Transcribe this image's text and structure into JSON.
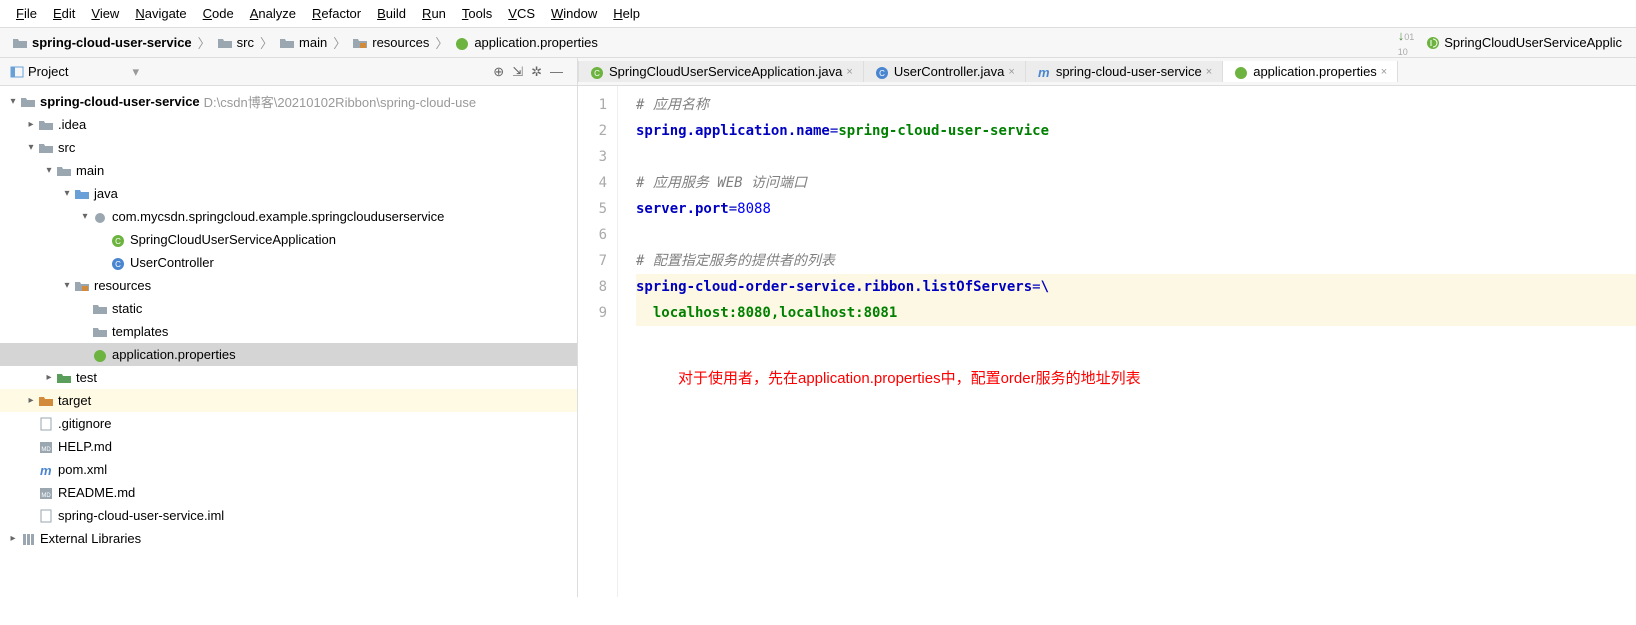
{
  "menu": [
    "File",
    "Edit",
    "View",
    "Navigate",
    "Code",
    "Analyze",
    "Refactor",
    "Build",
    "Run",
    "Tools",
    "VCS",
    "Window",
    "Help"
  ],
  "breadcrumb": [
    {
      "label": "spring-cloud-user-service",
      "bold": true,
      "icon": "folder"
    },
    {
      "label": "src",
      "icon": "folder"
    },
    {
      "label": "main",
      "icon": "folder"
    },
    {
      "label": "resources",
      "icon": "folder-res"
    },
    {
      "label": "application.properties",
      "icon": "spring"
    }
  ],
  "runConfig": "SpringCloudUserServiceApplic",
  "projectLabel": "Project",
  "tabs": [
    {
      "label": "SpringCloudUserServiceApplication.java",
      "icon": "java-spring",
      "active": false
    },
    {
      "label": "UserController.java",
      "icon": "java-class",
      "active": false
    },
    {
      "label": "spring-cloud-user-service",
      "icon": "maven",
      "active": false
    },
    {
      "label": "application.properties",
      "icon": "spring",
      "active": true
    }
  ],
  "tree": [
    {
      "depth": 0,
      "arrow": "down",
      "icon": "folder",
      "label": "spring-cloud-user-service",
      "bold": true,
      "suffix": " D:\\csdn博客\\20210102Ribbon\\spring-cloud-use"
    },
    {
      "depth": 1,
      "arrow": "right",
      "icon": "folder",
      "label": ".idea"
    },
    {
      "depth": 1,
      "arrow": "down",
      "icon": "folder",
      "label": "src"
    },
    {
      "depth": 2,
      "arrow": "down",
      "icon": "folder",
      "label": "main"
    },
    {
      "depth": 3,
      "arrow": "down",
      "icon": "folder-blue",
      "label": "java"
    },
    {
      "depth": 4,
      "arrow": "down",
      "icon": "package",
      "label": "com.mycsdn.springcloud.example.springclouduserservice"
    },
    {
      "depth": 5,
      "arrow": "",
      "icon": "java-spring",
      "label": "SpringCloudUserServiceApplication"
    },
    {
      "depth": 5,
      "arrow": "",
      "icon": "java-class",
      "label": "UserController"
    },
    {
      "depth": 3,
      "arrow": "down",
      "icon": "folder-res",
      "label": "resources"
    },
    {
      "depth": 4,
      "arrow": "",
      "icon": "folder",
      "label": "static"
    },
    {
      "depth": 4,
      "arrow": "",
      "icon": "folder",
      "label": "templates"
    },
    {
      "depth": 4,
      "arrow": "",
      "icon": "spring",
      "label": "application.properties",
      "selected": true
    },
    {
      "depth": 2,
      "arrow": "right",
      "icon": "folder-test",
      "label": "test"
    },
    {
      "depth": 1,
      "arrow": "right",
      "icon": "folder-orange",
      "label": "target",
      "highlighted": true
    },
    {
      "depth": 1,
      "arrow": "",
      "icon": "file",
      "label": ".gitignore"
    },
    {
      "depth": 1,
      "arrow": "",
      "icon": "md",
      "label": "HELP.md"
    },
    {
      "depth": 1,
      "arrow": "",
      "icon": "maven",
      "label": "pom.xml"
    },
    {
      "depth": 1,
      "arrow": "",
      "icon": "md",
      "label": "README.md"
    },
    {
      "depth": 1,
      "arrow": "",
      "icon": "file",
      "label": "spring-cloud-user-service.iml"
    },
    {
      "depth": 0,
      "arrow": "right",
      "icon": "lib",
      "label": "External Libraries"
    }
  ],
  "editor": {
    "lines": [
      {
        "n": 1,
        "type": "comment",
        "text": "# 应用名称"
      },
      {
        "n": 2,
        "type": "kv",
        "key": "spring.application.name",
        "val": "spring-cloud-user-service",
        "valClass": "c-val-green"
      },
      {
        "n": 3,
        "type": "blank"
      },
      {
        "n": 4,
        "type": "comment",
        "text": "# 应用服务 WEB 访问端口"
      },
      {
        "n": 5,
        "type": "kv",
        "key": "server.port",
        "val": "8088",
        "valClass": "c-val-blue"
      },
      {
        "n": 6,
        "type": "blank"
      },
      {
        "n": 7,
        "type": "comment",
        "text": "# 配置指定服务的提供者的列表"
      },
      {
        "n": 8,
        "type": "kvcont",
        "key": "spring-cloud-order-service.ribbon.listOfServers",
        "hl": true
      },
      {
        "n": 9,
        "type": "cont",
        "val": "  localhost:8080,localhost:8081",
        "hl": true
      }
    ],
    "annotation": "对于使用者，先在application.properties中，配置order服务的地址列表"
  }
}
